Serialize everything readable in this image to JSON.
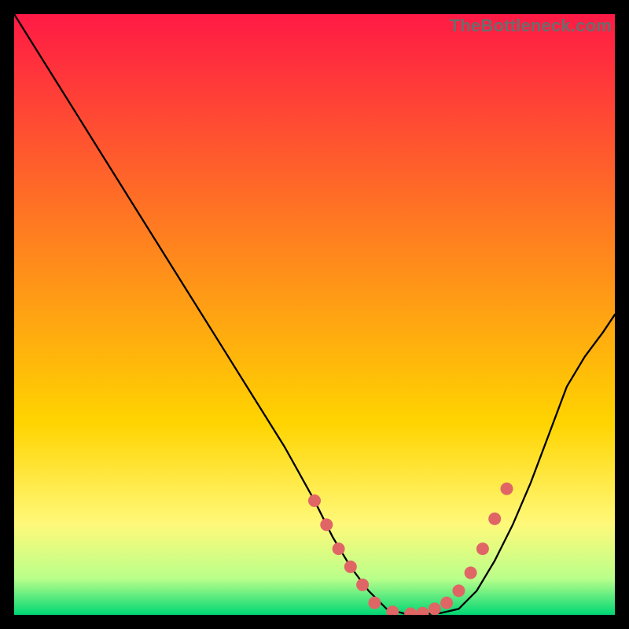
{
  "watermark": "TheBottleneck.com",
  "colors": {
    "frame": "#000000",
    "curve": "#000000",
    "marker": "#e06666",
    "gradient_top": "#ff1a45",
    "gradient_mid": "#ffd400",
    "gradient_yellow_pale": "#fff97a",
    "gradient_green_light": "#b9ff8a",
    "gradient_green": "#00d774"
  },
  "chart_data": {
    "type": "line",
    "title": "",
    "xlabel": "",
    "ylabel": "",
    "xlim": [
      0,
      100
    ],
    "ylim": [
      0,
      100
    ],
    "grid": false,
    "curve": {
      "x": [
        0,
        5,
        10,
        15,
        20,
        25,
        30,
        35,
        40,
        45,
        50,
        53,
        56,
        59,
        62,
        65,
        68,
        71,
        74,
        77,
        80,
        83,
        86,
        89,
        92,
        95,
        98,
        100
      ],
      "y": [
        100,
        92,
        84,
        76,
        68,
        60,
        52,
        44,
        36,
        28,
        19,
        13,
        8,
        4,
        1,
        0.2,
        0.1,
        0.3,
        1,
        4,
        9,
        15,
        22,
        30,
        38,
        43,
        47,
        50
      ]
    },
    "markers": {
      "x": [
        50,
        52,
        54,
        56,
        58,
        60,
        63,
        66,
        68,
        70,
        72,
        74,
        76,
        78,
        80,
        82
      ],
      "y": [
        19,
        15,
        11,
        8,
        5,
        2,
        0.5,
        0.2,
        0.3,
        1,
        2,
        4,
        7,
        11,
        16,
        21
      ]
    },
    "background_bands": [
      {
        "from": 0,
        "to": 68,
        "gradient": [
          "#ff1a45",
          "#ffd400"
        ]
      },
      {
        "from": 68,
        "to": 85,
        "gradient": [
          "#ffd400",
          "#fff97a"
        ]
      },
      {
        "from": 85,
        "to": 94,
        "gradient": [
          "#fff97a",
          "#b9ff8a"
        ]
      },
      {
        "from": 94,
        "to": 100,
        "gradient": [
          "#b9ff8a",
          "#00d774"
        ]
      }
    ]
  }
}
